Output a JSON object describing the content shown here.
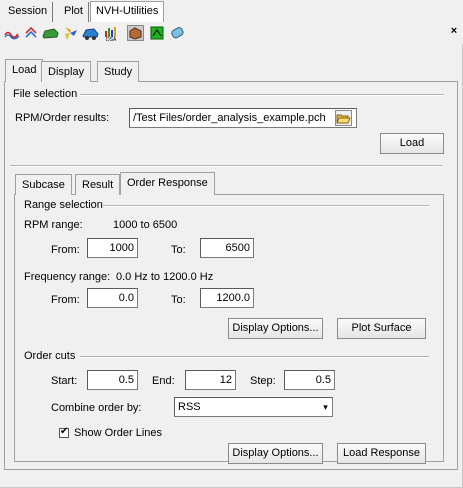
{
  "window": {
    "tabs": [
      {
        "label": "Session"
      },
      {
        "label": "Plot"
      },
      {
        "label": "NVH-Utilities"
      }
    ],
    "toolbar_icons": [
      "waves-icon",
      "chevrons-icon",
      "car-icon",
      "fan-icon",
      "car-blue-icon",
      "dsa-chart-icon",
      "brown-cube-icon",
      "green-square-icon",
      "cylinder-icon"
    ],
    "close_symbol": "×"
  },
  "main_tabs": [
    {
      "label": "Load"
    },
    {
      "label": "Display"
    },
    {
      "label": "Study"
    }
  ],
  "file_selection": {
    "title": "File selection",
    "results_label": "RPM/Order results:",
    "results_value": "/Test Files/order_analysis_example.pch",
    "load_button": "Load"
  },
  "sub_tabs": [
    {
      "label": "Subcase"
    },
    {
      "label": "Result"
    },
    {
      "label": "Order Response"
    }
  ],
  "range_selection": {
    "title": "Range selection",
    "rpm_range_label": "RPM range:",
    "rpm_range_value": "1000 to 6500",
    "from_label": "From:",
    "to_label": "To:",
    "rpm_from": "1000",
    "rpm_to": "6500",
    "freq_range_label": "Frequency range:",
    "freq_range_value": "0.0 Hz to 1200.0 Hz",
    "freq_from": "0.0",
    "freq_to": "1200.0",
    "display_options_button": "Display Options...",
    "plot_surface_button": "Plot Surface"
  },
  "order_cuts": {
    "title": "Order cuts",
    "start_label": "Start:",
    "start_value": "0.5",
    "end_label": "End:",
    "end_value": "12",
    "step_label": "Step:",
    "step_value": "0.5",
    "combine_label": "Combine order by:",
    "combine_value": "RSS",
    "show_lines_label": "Show Order Lines",
    "show_lines_checked": true,
    "display_options_button": "Display Options...",
    "load_response_button": "Load Response"
  }
}
